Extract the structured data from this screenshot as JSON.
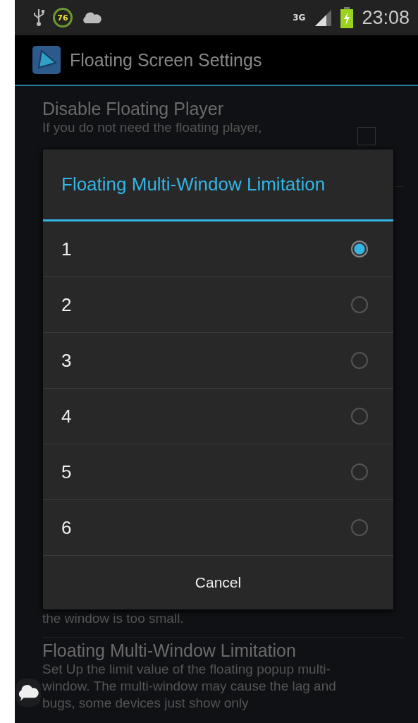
{
  "status_bar": {
    "battery_badge": "76",
    "network": "3G",
    "time": "23:08"
  },
  "action_bar": {
    "title": "Floating Screen Settings"
  },
  "settings": [
    {
      "kind": "checkbox",
      "title": "Disable Floating Player",
      "description": "If you do not need the floating player,",
      "checked": false
    },
    {
      "kind": "tail",
      "description": "the window is too small."
    },
    {
      "kind": "plain",
      "title": "Floating Multi-Window Limitation",
      "description": "Set Up the limit value of the floating popup multi-window. The multi-window may cause the lag and bugs, some devices just show only"
    }
  ],
  "dialog": {
    "title": "Floating Multi-Window Limitation",
    "options": [
      {
        "label": "1",
        "selected": true
      },
      {
        "label": "2",
        "selected": false
      },
      {
        "label": "3",
        "selected": false
      },
      {
        "label": "4",
        "selected": false
      },
      {
        "label": "5",
        "selected": false
      },
      {
        "label": "6",
        "selected": false
      }
    ],
    "button": "Cancel"
  }
}
